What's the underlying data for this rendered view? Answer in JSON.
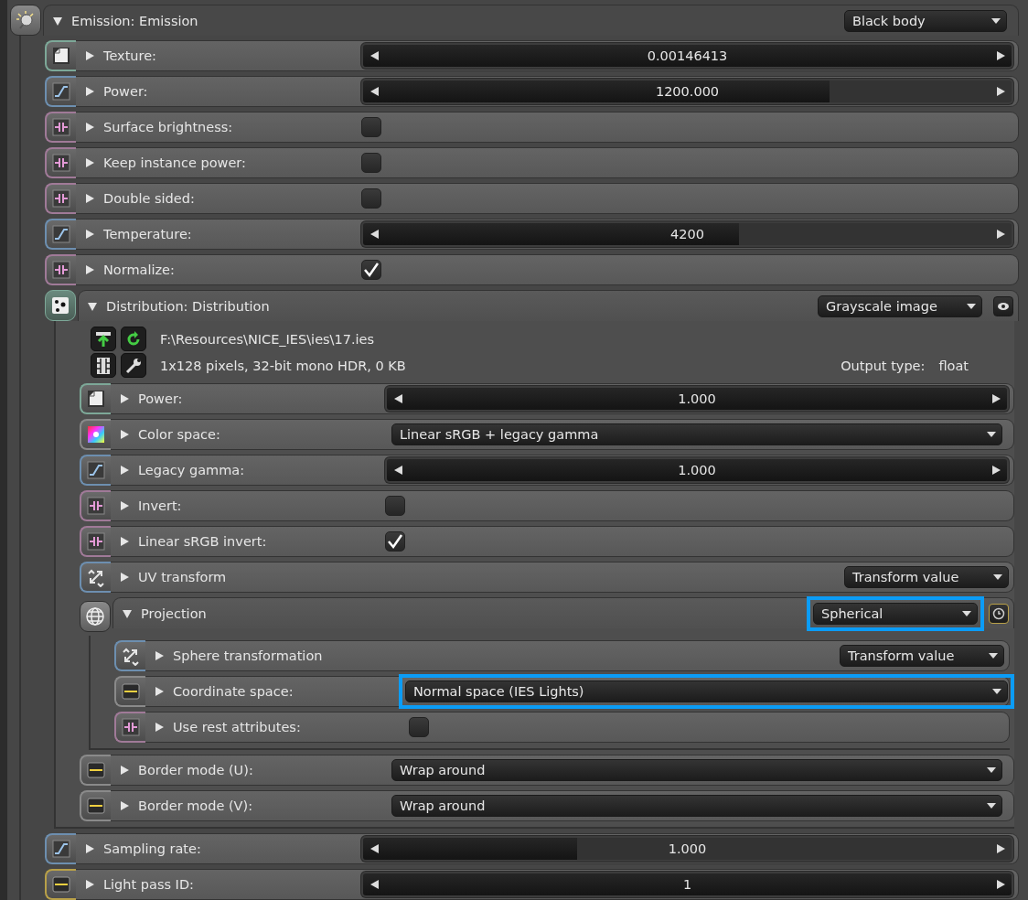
{
  "group": {
    "kind": "emission-group",
    "title": "Emission: Emission",
    "expanded": true,
    "mode": {
      "value": "Black body",
      "highlighted": false
    },
    "children": [
      {
        "kind": "texture-slider",
        "label": "Texture:",
        "expanded": false,
        "value": "0.00146413",
        "level": 1
      },
      {
        "kind": "float-slider",
        "label": "Power:",
        "expanded": false,
        "value": "1200.000",
        "level": 0.72
      },
      {
        "kind": "checkbox",
        "label": "Surface brightness:",
        "expanded": false,
        "checked": false
      },
      {
        "kind": "checkbox",
        "label": "Keep instance power:",
        "expanded": false,
        "checked": false
      },
      {
        "kind": "checkbox",
        "label": "Double sided:",
        "expanded": false,
        "checked": false
      },
      {
        "kind": "float-slider",
        "label": "Temperature:",
        "expanded": false,
        "value": "4200",
        "level": 0.58
      },
      {
        "kind": "checkbox",
        "label": "Normalize:",
        "expanded": false,
        "checked": true
      },
      {
        "kind": "image-group",
        "title": "Distribution: Distribution",
        "expanded": true,
        "mode": {
          "value": "Grayscale image",
          "highlighted": false
        },
        "file": {
          "path": "F:\\Resources\\NICE_IES\\ies\\17.ies",
          "info": "1x128 pixels, 32-bit mono HDR, 0 KB",
          "output_label": "Output type:",
          "output_value": "float"
        },
        "children": [
          {
            "kind": "texture-slider",
            "label": "Power:",
            "expanded": false,
            "value": "1.000",
            "level": 1
          },
          {
            "kind": "colorspace-enum",
            "label": "Color space:",
            "expanded": false,
            "value": "Linear sRGB + legacy gamma",
            "highlighted": false
          },
          {
            "kind": "float-slider",
            "label": "Legacy gamma:",
            "expanded": false,
            "value": "1.000",
            "level": 1
          },
          {
            "kind": "checkbox",
            "label": "Invert:",
            "expanded": false,
            "checked": false
          },
          {
            "kind": "checkbox",
            "label": "Linear sRGB invert:",
            "expanded": false,
            "checked": true
          },
          {
            "kind": "transform",
            "label": "UV transform",
            "expanded": false,
            "value": "Transform value"
          },
          {
            "kind": "projection-group",
            "title": "Projection",
            "expanded": true,
            "mode": {
              "value": "Spherical",
              "highlighted": true
            },
            "children": [
              {
                "kind": "transform",
                "label": "Sphere transformation",
                "expanded": false,
                "value": "Transform value"
              },
              {
                "kind": "enum",
                "label": "Coordinate space:",
                "expanded": false,
                "value": "Normal space (IES Lights)",
                "highlighted": true
              },
              {
                "kind": "checkbox",
                "label": "Use rest attributes:",
                "expanded": false,
                "checked": false
              }
            ]
          },
          {
            "kind": "enum",
            "label": "Border mode (U):",
            "expanded": false,
            "value": "Wrap around",
            "highlighted": false
          },
          {
            "kind": "enum",
            "label": "Border mode (V):",
            "expanded": false,
            "value": "Wrap around",
            "highlighted": false
          }
        ]
      },
      {
        "kind": "float-slider",
        "label": "Sampling rate:",
        "expanded": false,
        "value": "1.000",
        "level": 0.33
      },
      {
        "kind": "int-slider",
        "label": "Light pass ID:",
        "expanded": false,
        "value": "1",
        "level": 1
      }
    ]
  }
}
